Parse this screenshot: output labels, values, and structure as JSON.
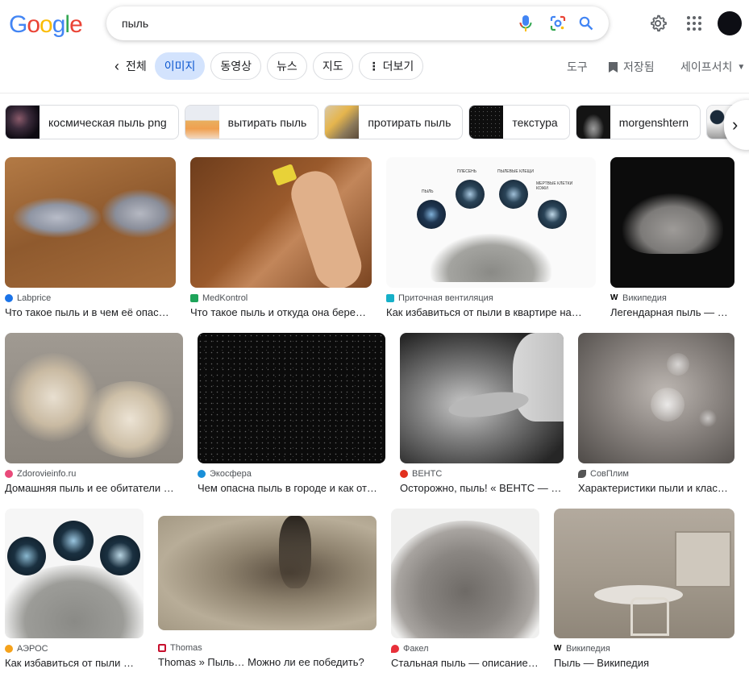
{
  "header": {
    "logo": "Google",
    "search_value": "пыль",
    "icons": [
      "mic-icon",
      "lens-icon",
      "search-icon",
      "gear-icon",
      "apps-icon"
    ]
  },
  "tabs": {
    "all": "전체",
    "images": "이미지",
    "videos": "동영상",
    "news": "뉴스",
    "maps": "지도",
    "more": "더보기",
    "tools": "도구",
    "saved": "저장됨",
    "safesearch": "세이프서치"
  },
  "related": [
    {
      "label": "космическая пыль png"
    },
    {
      "label": "вытирать пыль"
    },
    {
      "label": "протирать пыль"
    },
    {
      "label": "текстура"
    },
    {
      "label": "morgenshtern"
    }
  ],
  "results": [
    {
      "source": "Labprice",
      "title": "Что такое пыль и в чем её опас…"
    },
    {
      "source": "MedKontrol",
      "title": "Что такое пыль и откуда она бере…"
    },
    {
      "source": "Приточная вентиляция",
      "title": "Как избавиться от пыли в квартире на…"
    },
    {
      "source": "Википедия",
      "title": "Легендарная пыль — В…"
    },
    {
      "source": "Zdorovieinfo.ru",
      "title": "Домашняя пыль и ее обитатели …"
    },
    {
      "source": "Экосфера",
      "title": "Чем опасна пыль в городе и как от…"
    },
    {
      "source": "ВЕНТС",
      "title": "Осторожно, пыль! « ВЕНТС — о…"
    },
    {
      "source": "СовПлим",
      "title": "Характеристики пыли и клас…"
    },
    {
      "source": "АЭРОС",
      "title": "Как избавиться от пыли …"
    },
    {
      "source": "Thomas",
      "title": "Thomas » Пыль… Можно ли ее победить?"
    },
    {
      "source": "Факел",
      "title": "Стальная пыль — описание…"
    },
    {
      "source": "Википедия",
      "title": "Пыль — Википедия"
    }
  ],
  "diagram_labels": {
    "dust": "ПЫЛЬ",
    "mold": "ПЛЕСЕНЬ",
    "mites": "ПЫЛЕВЫЕ КЛЕЩИ",
    "skin": "МЕРТВЫЕ КЛЕТКИ КОЖИ"
  }
}
